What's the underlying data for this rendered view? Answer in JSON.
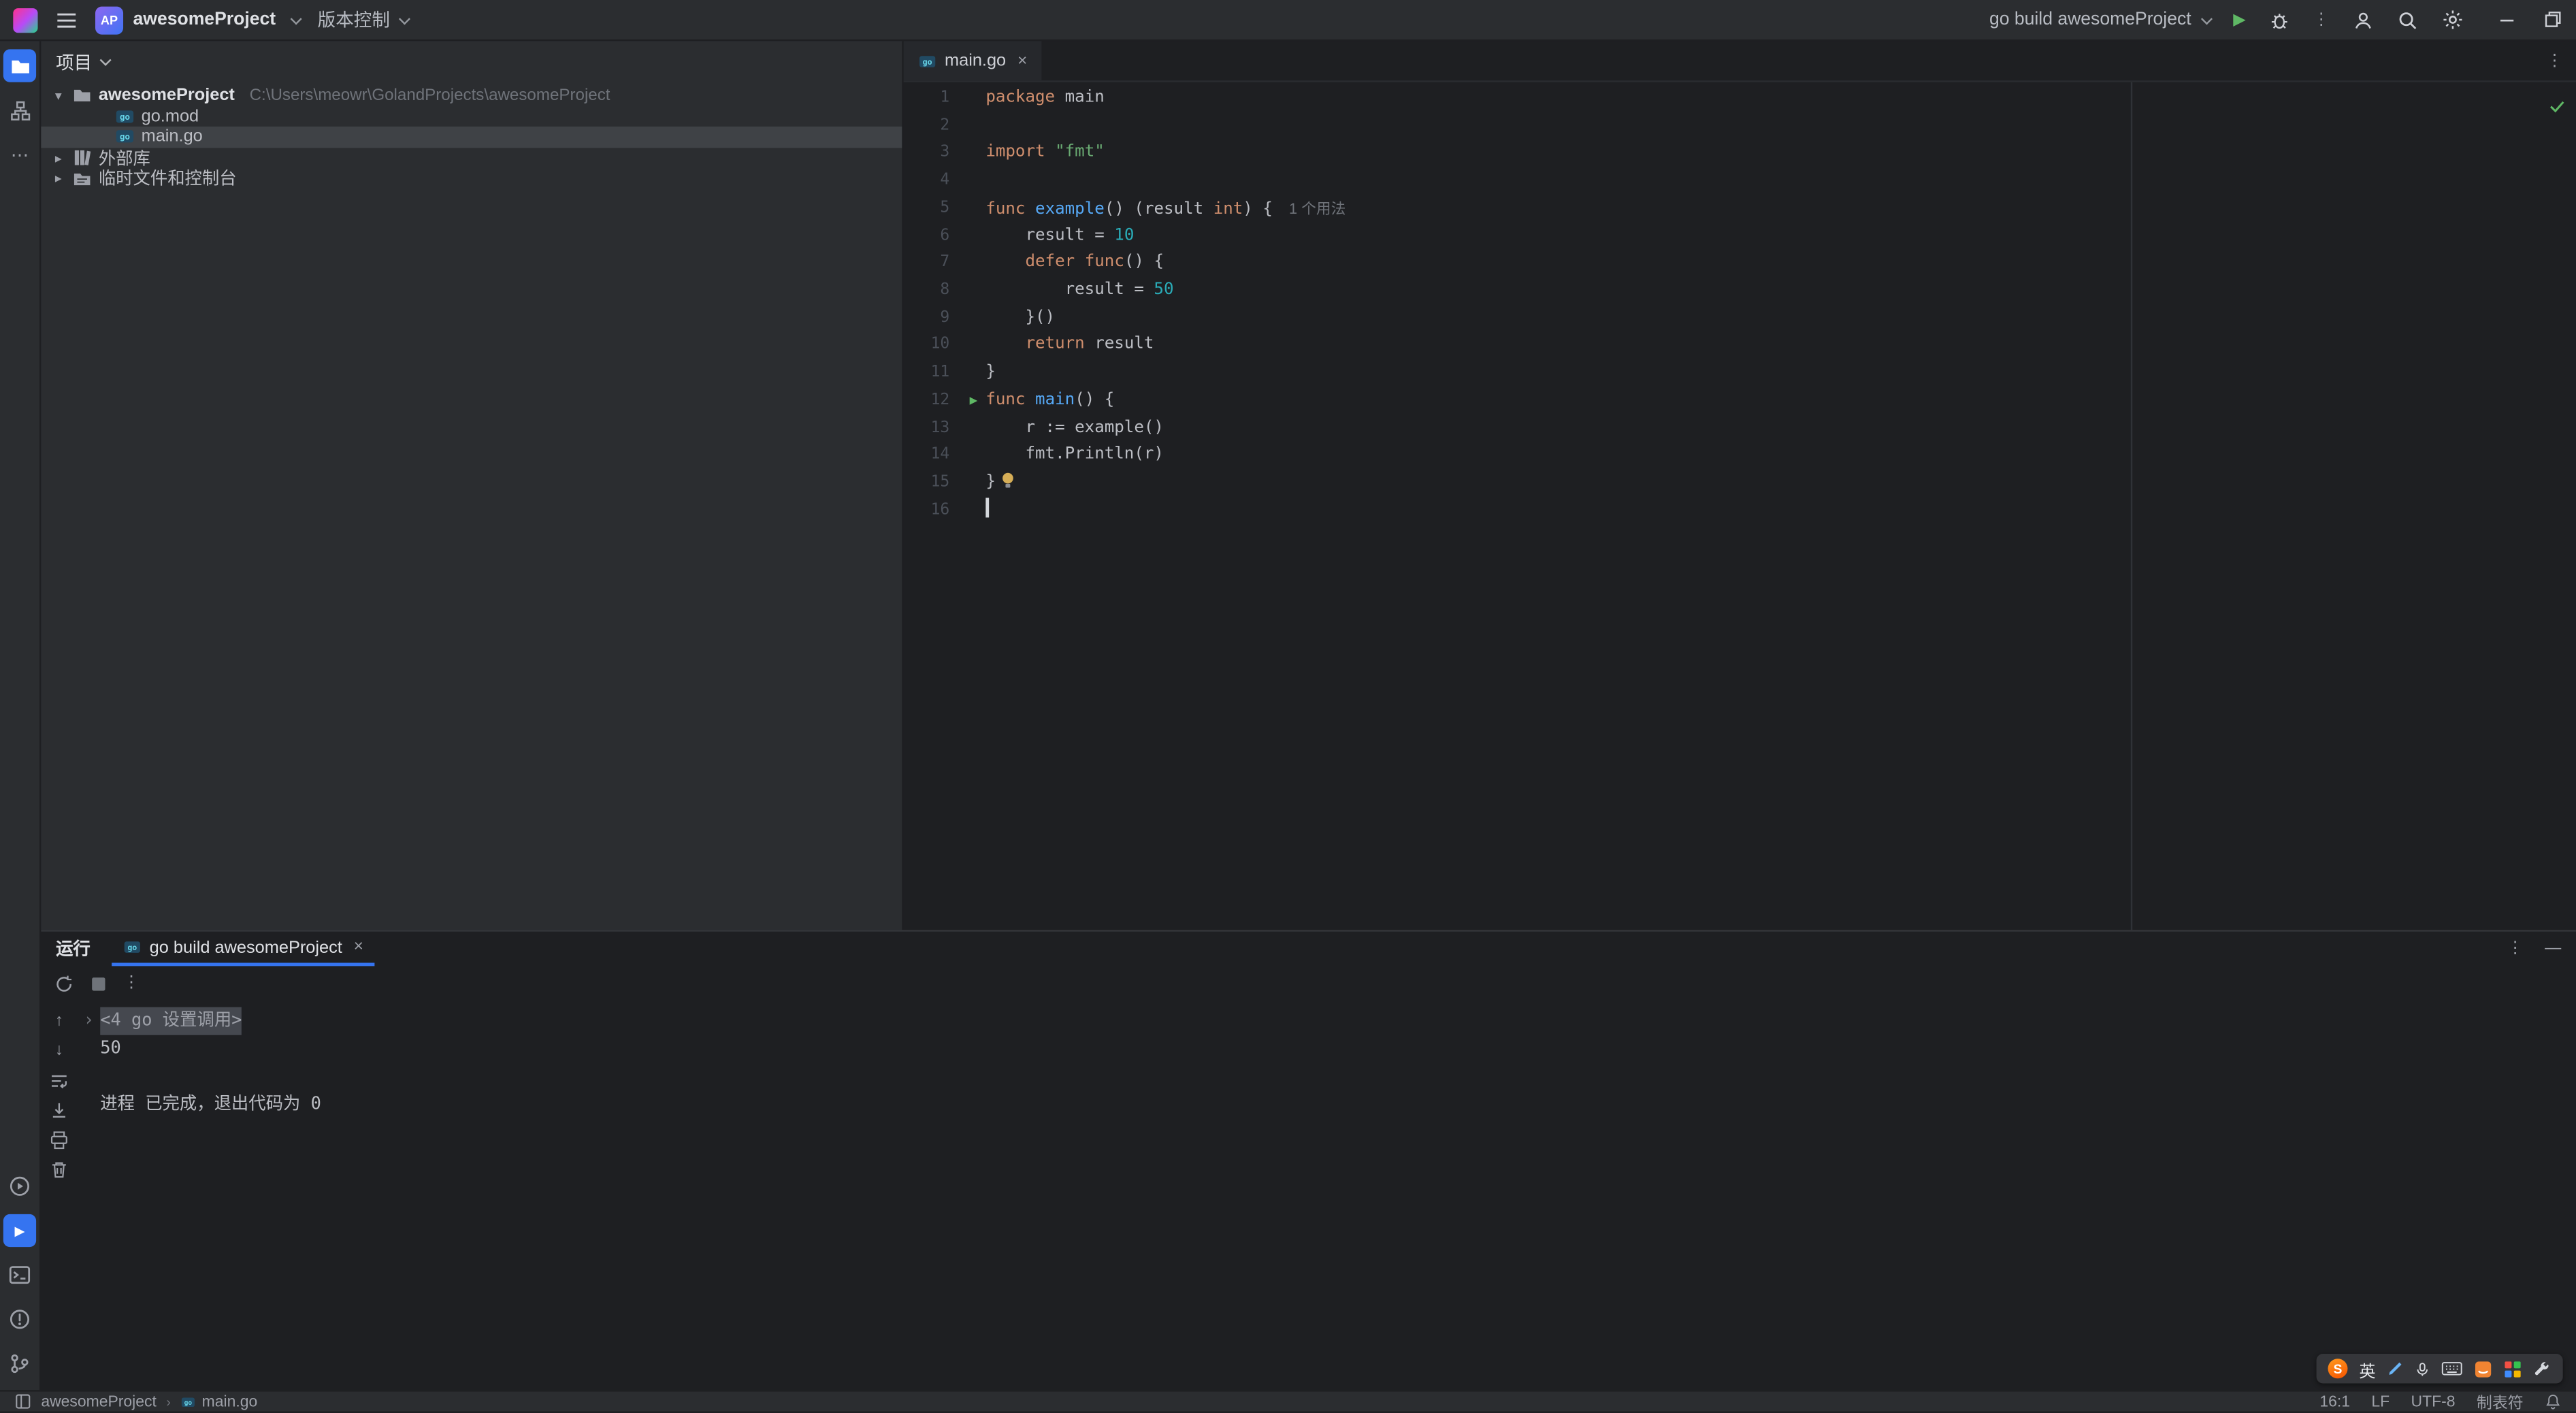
{
  "titlebar": {
    "project_badge": "AP",
    "project_name": "awesomeProject",
    "vcs": "版本控制",
    "run_config": "go build awesomeProject"
  },
  "project_panel": {
    "header": "项目",
    "tree": [
      {
        "chevron": "down",
        "icon": "folder",
        "label": "awesomeProject",
        "bold": true,
        "suffix": "C:\\Users\\meowr\\GolandProjects\\awesomeProject",
        "indent": 0,
        "selected": false
      },
      {
        "icon": "go",
        "label": "go.mod",
        "indent": 1,
        "selected": false
      },
      {
        "icon": "go",
        "label": "main.go",
        "indent": 1,
        "selected": true
      },
      {
        "chevron": "right",
        "icon": "library",
        "label": "外部库",
        "indent": 0,
        "selected": false
      },
      {
        "chevron": "right",
        "icon": "scratch",
        "label": "临时文件和控制台",
        "indent": 0,
        "selected": false
      }
    ]
  },
  "editor": {
    "tab_label": "main.go",
    "usage_hint": "1 个用法",
    "lines": [
      {
        "n": "1",
        "t": [
          [
            "kw",
            "package"
          ],
          [
            "txt",
            " main"
          ]
        ]
      },
      {
        "n": "2",
        "t": []
      },
      {
        "n": "3",
        "t": [
          [
            "kw",
            "import"
          ],
          [
            "txt",
            " "
          ],
          [
            "str",
            "\"fmt\""
          ]
        ]
      },
      {
        "n": "4",
        "t": []
      },
      {
        "n": "5",
        "t": [
          [
            "kw",
            "func"
          ],
          [
            "txt",
            " "
          ],
          [
            "fn",
            "example"
          ],
          [
            "txt",
            "() (result "
          ],
          [
            "kw",
            "int"
          ],
          [
            "txt",
            ") {"
          ],
          [
            "hint",
            "1 个用法"
          ]
        ]
      },
      {
        "n": "6",
        "t": [
          [
            "txt",
            "    result = "
          ],
          [
            "num",
            "10"
          ]
        ]
      },
      {
        "n": "7",
        "t": [
          [
            "txt",
            "    "
          ],
          [
            "kw",
            "defer"
          ],
          [
            "txt",
            " "
          ],
          [
            "kw",
            "func"
          ],
          [
            "txt",
            "() {"
          ]
        ]
      },
      {
        "n": "8",
        "t": [
          [
            "txt",
            "        result = "
          ],
          [
            "num",
            "50"
          ]
        ]
      },
      {
        "n": "9",
        "t": [
          [
            "txt",
            "    }()"
          ]
        ]
      },
      {
        "n": "10",
        "t": [
          [
            "txt",
            "    "
          ],
          [
            "kw",
            "return"
          ],
          [
            "txt",
            " result"
          ]
        ]
      },
      {
        "n": "11",
        "t": [
          [
            "txt",
            "}"
          ]
        ]
      },
      {
        "n": "12",
        "gutter": "run",
        "t": [
          [
            "kw",
            "func"
          ],
          [
            "txt",
            " "
          ],
          [
            "fn",
            "main"
          ],
          [
            "txt",
            "() {"
          ]
        ]
      },
      {
        "n": "13",
        "t": [
          [
            "txt",
            "    r := example()"
          ]
        ]
      },
      {
        "n": "14",
        "t": [
          [
            "txt",
            "    fmt.Println(r)"
          ]
        ]
      },
      {
        "n": "15",
        "t": [
          [
            "txt",
            "}"
          ],
          [
            "bulb",
            ""
          ]
        ]
      },
      {
        "n": "16",
        "cursor": true,
        "t": []
      }
    ]
  },
  "run_panel": {
    "title": "运行",
    "tab_label": "go build awesomeProject",
    "console": [
      {
        "fold": true,
        "selected": true,
        "text": "<4 go 设置调用>"
      },
      {
        "text": "50"
      },
      {
        "text": ""
      },
      {
        "text": "进程 已完成，退出代码为 0"
      }
    ]
  },
  "status_bar": {
    "project": "awesomeProject",
    "file": "main.go",
    "caret": "16:1",
    "line_sep": "LF",
    "encoding": "UTF-8",
    "indent": "制表符"
  },
  "ime": {
    "logo": "S",
    "mode": "英"
  }
}
